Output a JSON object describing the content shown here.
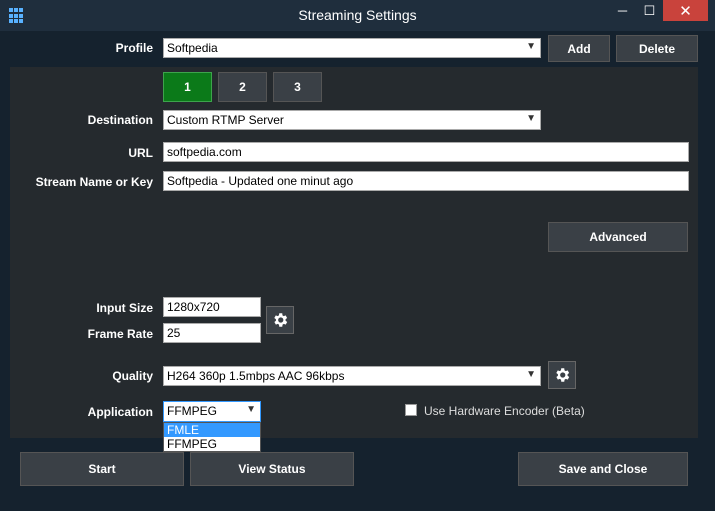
{
  "window": {
    "title": "Streaming Settings",
    "min_glyph": "─",
    "max_glyph": "☐",
    "close_glyph": "✕"
  },
  "profile": {
    "label": "Profile",
    "value": "Softpedia",
    "add_label": "Add",
    "delete_label": "Delete"
  },
  "tabs": [
    {
      "label": "1",
      "active": true
    },
    {
      "label": "2",
      "active": false
    },
    {
      "label": "3",
      "active": false
    }
  ],
  "destination": {
    "label": "Destination",
    "value": "Custom RTMP Server"
  },
  "url": {
    "label": "URL",
    "value": "softpedia.com"
  },
  "stream_key": {
    "label": "Stream Name or Key",
    "value": "Softpedia - Updated one minut ago"
  },
  "advanced_label": "Advanced",
  "input_size": {
    "label": "Input Size",
    "value": "1280x720"
  },
  "frame_rate": {
    "label": "Frame Rate",
    "value": "25"
  },
  "quality": {
    "label": "Quality",
    "value": "H264 360p 1.5mbps AAC 96kbps"
  },
  "application": {
    "label": "Application",
    "value": "FFMPEG",
    "options": [
      "FMLE",
      "FFMPEG"
    ],
    "highlighted": "FMLE"
  },
  "hw_encoder": {
    "label": "Use Hardware Encoder (Beta)",
    "checked": false
  },
  "bottom": {
    "start_label": "Start",
    "view_status_label": "View Status",
    "save_close_label": "Save and Close"
  },
  "colors": {
    "tab_active": "#0b7a19",
    "close_button": "#c9433c",
    "accent": "#3399ff"
  },
  "icons": [
    "app-grid-icon",
    "gear-icon",
    "chevron-down-icon"
  ]
}
